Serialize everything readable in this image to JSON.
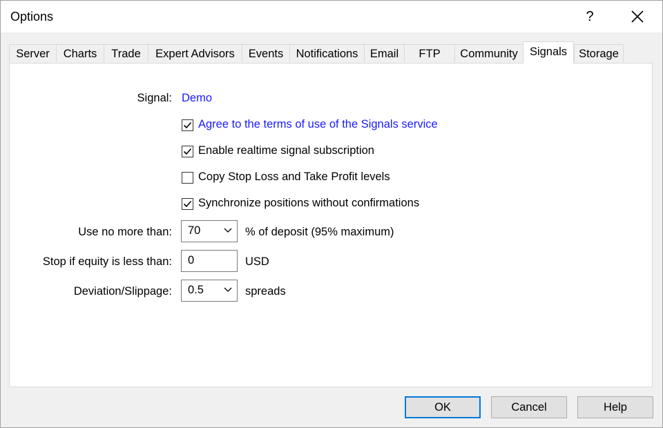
{
  "window": {
    "title": "Options",
    "help_label": "?"
  },
  "tabs": [
    {
      "label": "Server"
    },
    {
      "label": "Charts"
    },
    {
      "label": "Trade"
    },
    {
      "label": "Expert Advisors"
    },
    {
      "label": "Events"
    },
    {
      "label": "Notifications"
    },
    {
      "label": "Email"
    },
    {
      "label": "FTP"
    },
    {
      "label": "Community"
    },
    {
      "label": "Signals"
    },
    {
      "label": "Storage"
    }
  ],
  "active_tab": "Signals",
  "signals": {
    "signal_label": "Signal:",
    "signal_value": "Demo",
    "agree": {
      "label": "Agree to the terms of use of the Signals service",
      "checked": true
    },
    "realtime": {
      "label": "Enable realtime signal subscription",
      "checked": true
    },
    "copy_sltp": {
      "label": "Copy Stop Loss and Take Profit levels",
      "checked": false
    },
    "sync": {
      "label": "Synchronize positions without confirmations",
      "checked": true
    },
    "use_no_more": {
      "label": "Use no more than:",
      "value": "70",
      "suffix": "% of deposit (95% maximum)"
    },
    "stop_equity": {
      "label": "Stop if equity is less than:",
      "value": "0",
      "suffix": "USD"
    },
    "deviation": {
      "label": "Deviation/Slippage:",
      "value": "0.5",
      "suffix": "spreads"
    }
  },
  "buttons": {
    "ok": "OK",
    "cancel": "Cancel",
    "help": "Help"
  }
}
